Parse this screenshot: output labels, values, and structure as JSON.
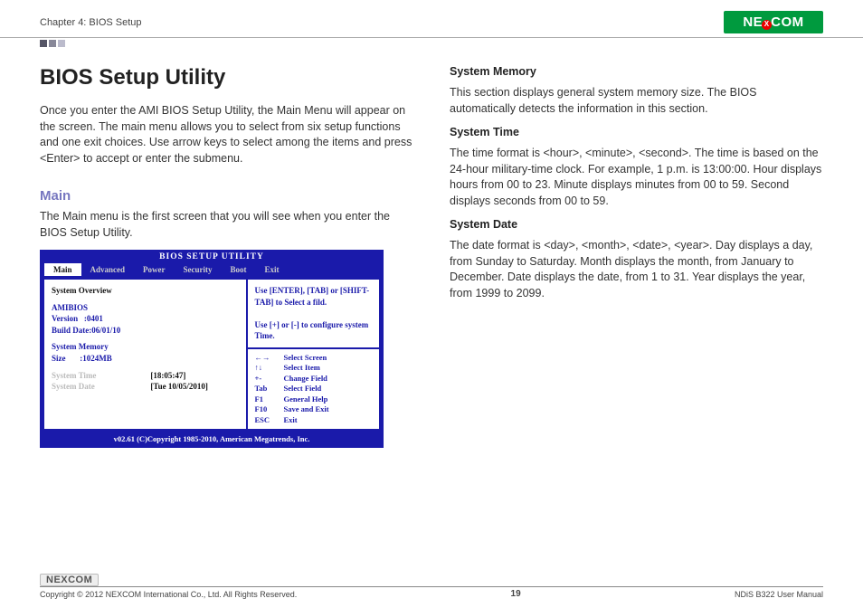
{
  "header": {
    "chapter": "Chapter 4: BIOS Setup",
    "logo_text_left": "NE",
    "logo_text_x": "X",
    "logo_text_right": "COM"
  },
  "left_col": {
    "h1": "BIOS Setup Utility",
    "intro": "Once you enter the AMI BIOS Setup Utility, the Main Menu will appear on the screen. The main menu allows you to select from six setup functions and one exit choices. Use arrow keys to select among the items and press <Enter> to accept or enter the submenu.",
    "main_heading": "Main",
    "main_text": "The Main menu is the first screen that you will see when you enter the BIOS Setup Utility."
  },
  "bios": {
    "title": "BIOS SETUP UTILITY",
    "tabs": [
      "Main",
      "Advanced",
      "Power",
      "Security",
      "Boot",
      "Exit"
    ],
    "overview_label": "System Overview",
    "amibios_label": "AMIBIOS",
    "version_label": "Version",
    "version_value": ":0401",
    "build_label": "Build Date",
    "build_value": ":06/01/10",
    "memory_label": "System Memory",
    "size_label": "Size",
    "size_value": ":1024MB",
    "time_label": "System Time",
    "date_label": "System Date",
    "time_value": "[18:05:47]",
    "date_value": "[Tue 10/05/2010]",
    "help1": "Use [ENTER], [TAB] or [SHIFT-TAB] to Select a fild.",
    "help2": "Use [+] or [-] to configure system Time.",
    "nav": [
      {
        "key": "←→",
        "label": "Select Screen"
      },
      {
        "key": "↑↓",
        "label": "Select Item"
      },
      {
        "key": "+-",
        "label": "Change Field"
      },
      {
        "key": "Tab",
        "label": "Select Field"
      },
      {
        "key": "F1",
        "label": "General Help"
      },
      {
        "key": "F10",
        "label": "Save and Exit"
      },
      {
        "key": "ESC",
        "label": "Exit"
      }
    ],
    "footer": "v02.61 (C)Copyright 1985-2010, American Megatrends, Inc."
  },
  "right_col": {
    "sm_head": "System Memory",
    "sm_text": "This section displays general system memory size. The BIOS automatically detects the information in this section.",
    "st_head": "System Time",
    "st_text": "The time format is <hour>, <minute>, <second>. The time is based on the 24-hour military-time clock. For example, 1 p.m. is 13:00:00. Hour displays hours from 00 to 23. Minute displays minutes from 00 to 59. Second displays seconds from 00 to 59.",
    "sd_head": "System Date",
    "sd_text": "The date format is <day>, <month>, <date>, <year>. Day displays a day, from Sunday to Saturday. Month displays the month, from January to December. Date displays the date, from 1 to 31. Year displays the year, from 1999 to 2099."
  },
  "footer": {
    "logo": "NEXCOM",
    "copyright": "Copyright © 2012 NEXCOM International Co., Ltd. All Rights Reserved.",
    "page": "19",
    "manual": "NDiS B322 User Manual"
  }
}
